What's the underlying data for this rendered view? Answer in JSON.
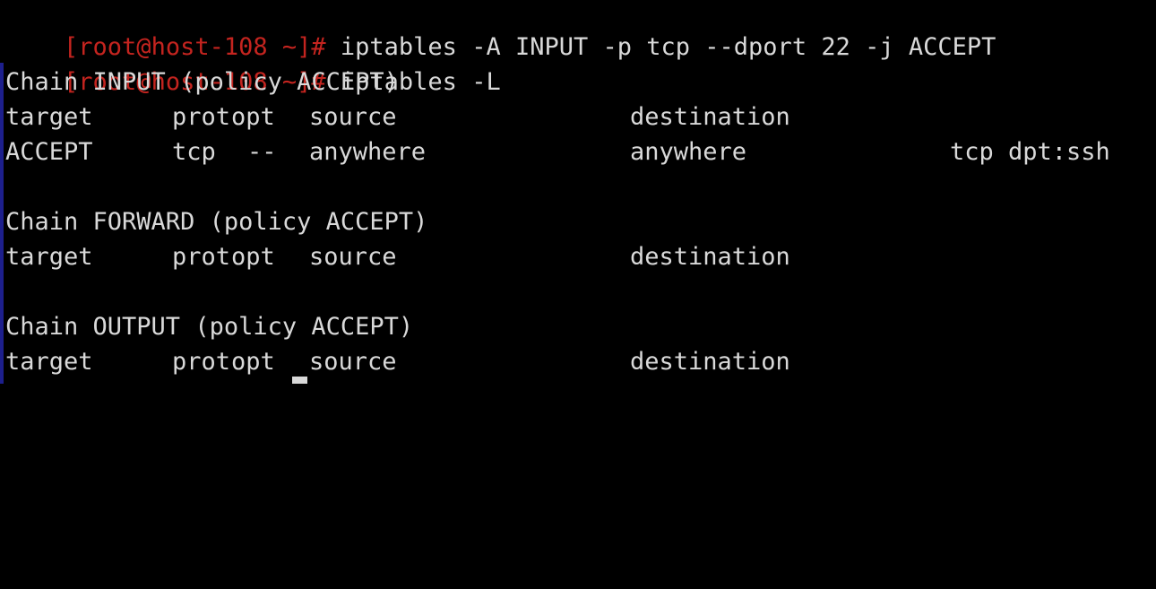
{
  "colors": {
    "background": "#000000",
    "text": "#d9d9d9",
    "prompt": "#c4241f",
    "left_edge_marker": "#1d1f8c"
  },
  "commands": [
    {
      "prompt": "[root@host-108 ~]#",
      "command": " iptables -A INPUT -p tcp --dport 22 -j ACCEPT"
    },
    {
      "prompt": "[root@host-108 ~]#",
      "command": " iptables -L"
    }
  ],
  "chains": [
    {
      "header": "Chain INPUT (policy ACCEPT)",
      "columns": {
        "target": "target",
        "prot": "prot",
        "opt": "opt",
        "source": "source",
        "destination": "destination"
      },
      "rules": [
        {
          "target": "ACCEPT",
          "prot": "tcp",
          "opt": "--",
          "source": "anywhere",
          "destination": "anywhere",
          "extra": "tcp dpt:ssh"
        }
      ]
    },
    {
      "header": "Chain FORWARD (policy ACCEPT)",
      "columns": {
        "target": "target",
        "prot": "prot",
        "opt": "opt",
        "source": "source",
        "destination": "destination"
      },
      "rules": []
    },
    {
      "header": "Chain OUTPUT (policy ACCEPT)",
      "columns": {
        "target": "target",
        "prot": "prot",
        "opt": "opt",
        "source": "source",
        "destination": "destination"
      },
      "rules": []
    }
  ]
}
